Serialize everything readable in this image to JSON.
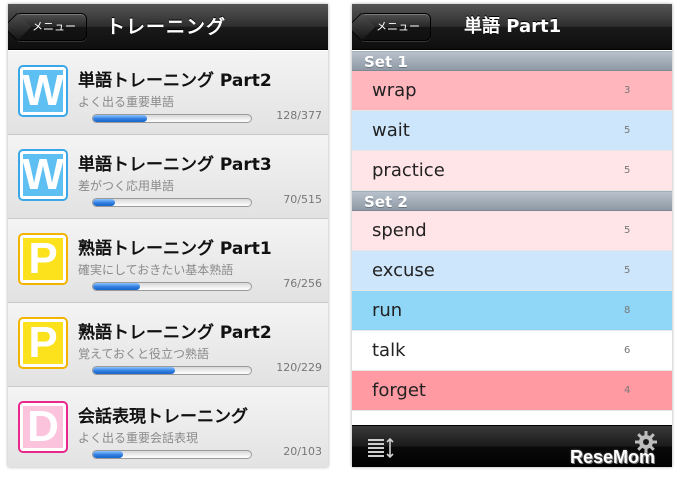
{
  "left_screen": {
    "back_button": "メニュー",
    "title": "トレーニング",
    "items": [
      {
        "icon": "W",
        "title": "単語トレーニング Part2",
        "subtitle": "よく出る重要単語",
        "count": "128/377",
        "progress": 0.34
      },
      {
        "icon": "W",
        "title": "単語トレーニング Part3",
        "subtitle": "差がつく応用単語",
        "count": "70/515",
        "progress": 0.14
      },
      {
        "icon": "P",
        "title": "熟語トレーニング Part1",
        "subtitle": "確実にしておきたい基本熟語",
        "count": "76/256",
        "progress": 0.3
      },
      {
        "icon": "P",
        "title": "熟語トレーニング Part2",
        "subtitle": "覚えておくと役立つ熟語",
        "count": "120/229",
        "progress": 0.52
      },
      {
        "icon": "D",
        "title": "会話表現トレーニング",
        "subtitle": "よく出る重要会話表現",
        "count": "20/103",
        "progress": 0.19
      }
    ]
  },
  "right_screen": {
    "back_button": "メニュー",
    "title": "単語 Part1",
    "sets": [
      {
        "label": "Set 1",
        "words": [
          {
            "word": "wrap",
            "count": "3",
            "color": "#ffb6bd"
          },
          {
            "word": "wait",
            "count": "5",
            "color": "#cde6fb"
          },
          {
            "word": "practice",
            "count": "5",
            "color": "#ffe4e8"
          }
        ]
      },
      {
        "label": "Set 2",
        "words": [
          {
            "word": "spend",
            "count": "5",
            "color": "#ffe4e8"
          },
          {
            "word": "excuse",
            "count": "5",
            "color": "#cde6fb"
          },
          {
            "word": "run",
            "count": "8",
            "color": "#8fd6f7"
          },
          {
            "word": "talk",
            "count": "6",
            "color": "#ffffff"
          },
          {
            "word": "forget",
            "count": "4",
            "color": "#ff9aa3"
          }
        ]
      }
    ],
    "toolbar": {
      "left_icon": "sort-list-icon",
      "right_icon": "gear-icon"
    }
  },
  "watermark": "ReseMom"
}
